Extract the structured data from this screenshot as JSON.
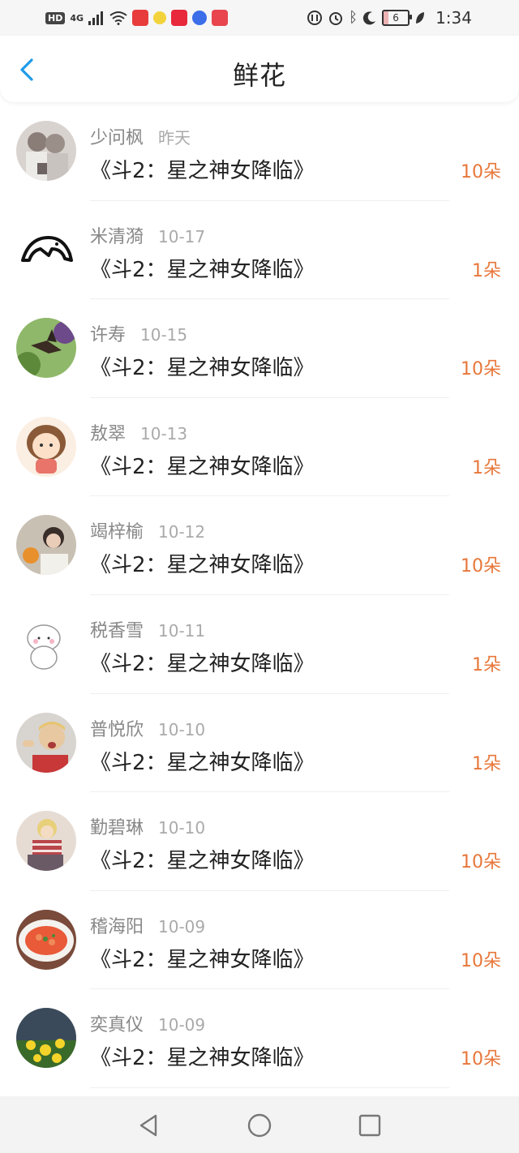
{
  "status_bar": {
    "network_hd": "HD",
    "network_type": "4G",
    "battery_level": "6",
    "time": "1:34"
  },
  "header": {
    "title": "鲜花"
  },
  "records": [
    {
      "name": "少问枫",
      "date": "昨天",
      "book": "《斗2：星之神女降临》",
      "count": "10朵"
    },
    {
      "name": "米清漪",
      "date": "10-17",
      "book": "《斗2：星之神女降临》",
      "count": "1朵"
    },
    {
      "name": "许寿",
      "date": "10-15",
      "book": "《斗2：星之神女降临》",
      "count": "10朵"
    },
    {
      "name": "敖翠",
      "date": "10-13",
      "book": "《斗2：星之神女降临》",
      "count": "1朵"
    },
    {
      "name": "竭梓榆",
      "date": "10-12",
      "book": "《斗2：星之神女降临》",
      "count": "10朵"
    },
    {
      "name": "税香雪",
      "date": "10-11",
      "book": "《斗2：星之神女降临》",
      "count": "1朵"
    },
    {
      "name": "普悦欣",
      "date": "10-10",
      "book": "《斗2：星之神女降临》",
      "count": "1朵"
    },
    {
      "name": "勤碧琳",
      "date": "10-10",
      "book": "《斗2：星之神女降临》",
      "count": "10朵"
    },
    {
      "name": "稽海阳",
      "date": "10-09",
      "book": "《斗2：星之神女降临》",
      "count": "10朵"
    },
    {
      "name": "奕真仪",
      "date": "10-09",
      "book": "《斗2：星之神女降临》",
      "count": "10朵"
    }
  ],
  "colors": {
    "accent_count": "#e8773a",
    "back_arrow": "#1e9be8"
  }
}
